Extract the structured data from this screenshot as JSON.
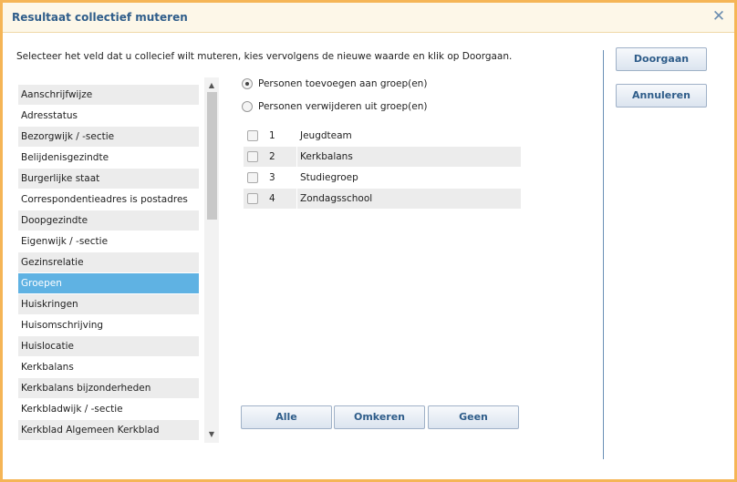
{
  "dialog": {
    "title": "Resultaat collectief muteren",
    "close_symbol": "✕"
  },
  "instruction": "Selecteer het veld dat u collecief wilt muteren, kies vervolgens de nieuwe waarde en klik op Doorgaan.",
  "fields": [
    "Aanschrijfwijze",
    "Adresstatus",
    "Bezorgwijk / -sectie",
    "Belijdenisgezindte",
    "Burgerlijke staat",
    "Correspondentieadres is postadres",
    "Doopgezindte",
    "Eigenwijk / -sectie",
    "Gezinsrelatie",
    "Groepen",
    "Huiskringen",
    "Huisomschrijving",
    "Huislocatie",
    "Kerkbalans",
    "Kerkbalans bijzonderheden",
    "Kerkbladwijk / -sectie",
    "Kerkblad Algemeen Kerkblad"
  ],
  "selected_field": "Groepen",
  "scroll": {
    "up_symbol": "▲",
    "down_symbol": "▼"
  },
  "options": {
    "add": "Personen toevoegen aan groep(en)",
    "remove": "Personen verwijderen uit groep(en)",
    "selected": "add"
  },
  "groups": [
    {
      "num": "1",
      "name": "Jeugdteam"
    },
    {
      "num": "2",
      "name": "Kerkbalans"
    },
    {
      "num": "3",
      "name": "Studiegroep"
    },
    {
      "num": "4",
      "name": "Zondagsschool"
    }
  ],
  "buttons": {
    "all": "Alle",
    "invert": "Omkeren",
    "none": "Geen",
    "continue": "Doorgaan",
    "cancel": "Annuleren"
  },
  "colors": {
    "border": "#f5b556",
    "title": "#2f5d8a",
    "selected_row": "#5fb2e3"
  }
}
